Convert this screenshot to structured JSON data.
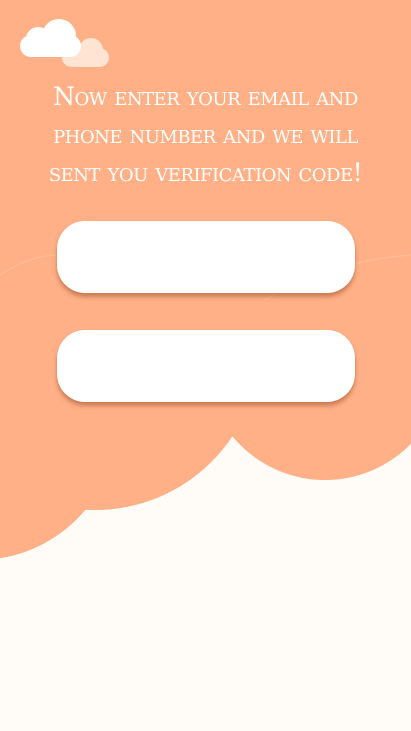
{
  "screen": {
    "headline": "Now enter your email and phone number and we will sent you verification code!"
  },
  "form": {
    "email": {
      "value": "",
      "placeholder": ""
    },
    "phone": {
      "value": "",
      "placeholder": ""
    }
  },
  "colors": {
    "background": "#fffbf7",
    "cloud_peach": "#ffb086",
    "cloud_highlight": "#ffb98f",
    "field": "#ffffff",
    "text": "#ffffff"
  },
  "icons": [
    "cloud-icon",
    "small-cloud-icon"
  ]
}
